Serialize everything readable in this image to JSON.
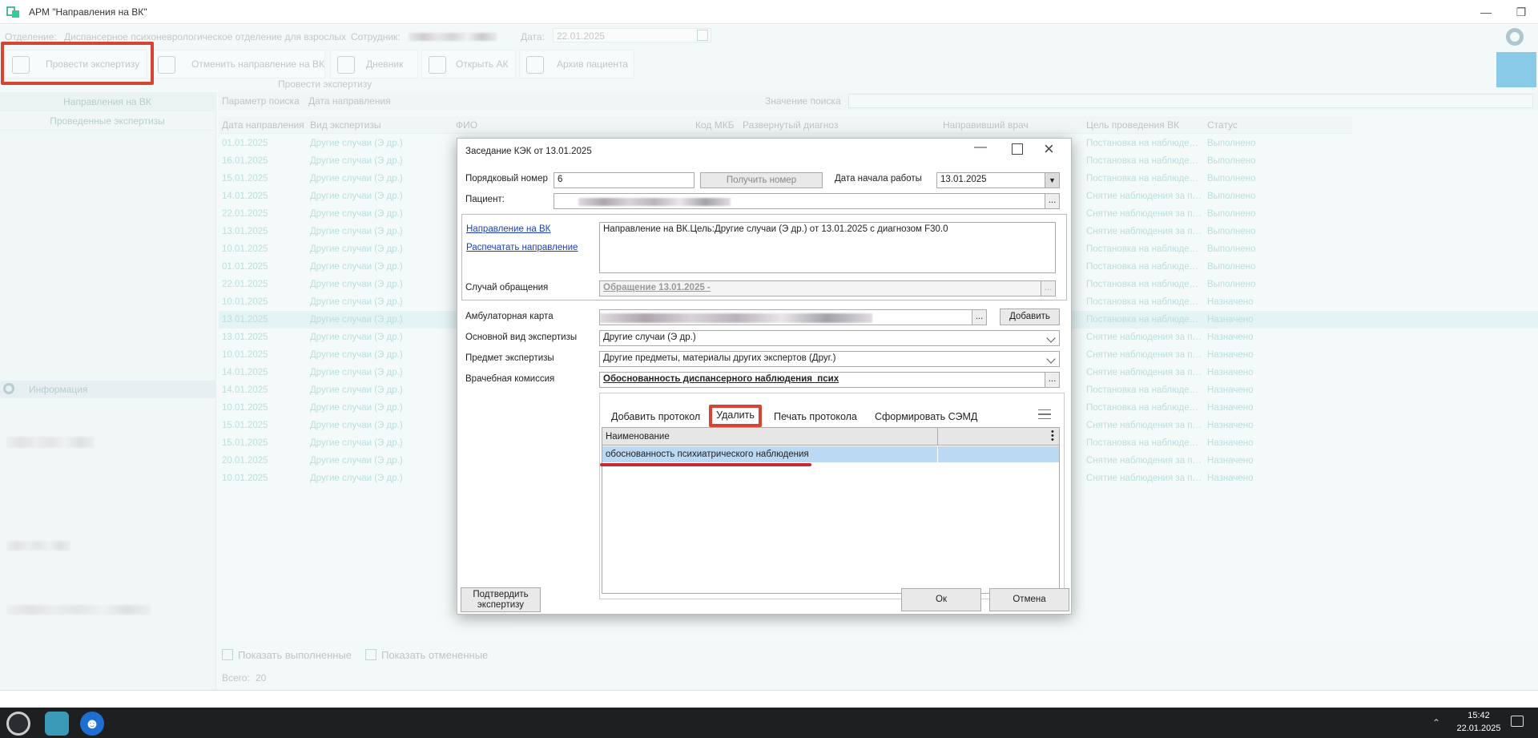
{
  "window": {
    "title": "АРМ \"Направления на ВК\""
  },
  "header": {
    "department_label": "Отделение:",
    "department_value": "Диспансерное психоневрологическое отделение для взрослых",
    "employee_label": "Сотрудник:",
    "date_label": "Дата:",
    "date_value": "22.01.2025"
  },
  "toolbar": {
    "items": [
      {
        "label": "Провести экспертизу",
        "icon": "experts-search-icon"
      },
      {
        "label": "Отменить направление на ВК",
        "icon": "experts-cancel-icon"
      },
      {
        "label": "Дневник",
        "icon": "book-icon"
      },
      {
        "label": "Открыть АК",
        "icon": "archive-box-icon"
      },
      {
        "label": "Архив пациента",
        "icon": "patient-archive-icon"
      }
    ],
    "group_caption": "Провести экспертизу",
    "accent_highlight": "#d64534"
  },
  "left_panel": {
    "items": [
      "Направления на ВК",
      "Проведенные экспертизы"
    ],
    "info_label": "Информация"
  },
  "search": {
    "param_label": "Параметр поиска",
    "param_value": "Дата направления",
    "value_label": "Значение поиска"
  },
  "grid": {
    "columns": [
      "Дата направления",
      "Вид экспертизы",
      "ФИО",
      "Код МКБ",
      "Развернутый диагноз",
      "Направивший врач",
      "Цель проведения ВК",
      "Статус"
    ],
    "rows": [
      {
        "date": "01.01.2025",
        "type": "Другие случаи (Э др.)",
        "goal": "Постановка на наблюдени...",
        "status": "Выполнено"
      },
      {
        "date": "16.01.2025",
        "type": "Другие случаи (Э др.)",
        "goal": "Постановка на наблюдени...",
        "status": "Выполнено"
      },
      {
        "date": "15.01.2025",
        "type": "Другие случаи (Э др.)",
        "goal": "Постановка на наблюдени...",
        "status": "Выполнено"
      },
      {
        "date": "14.01.2025",
        "type": "Другие случаи (Э др.)",
        "goal": "Снятие наблюдения за пац...",
        "status": "Выполнено"
      },
      {
        "date": "22.01.2025",
        "type": "Другие случаи (Э др.)",
        "goal": "Снятие наблюдения за пац...",
        "status": "Выполнено"
      },
      {
        "date": "13.01.2025",
        "type": "Другие случаи (Э др.)",
        "goal": "Снятие наблюдения за пац...",
        "status": "Выполнено"
      },
      {
        "date": "10.01.2025",
        "type": "Другие случаи (Э др.)",
        "goal": "Постановка на наблюдени...",
        "status": "Выполнено"
      },
      {
        "date": "01.01.2025",
        "type": "Другие случаи (Э др.)",
        "goal": "Постановка на наблюдени...",
        "status": "Выполнено"
      },
      {
        "date": "22.01.2025",
        "type": "Другие случаи (Э др.)",
        "goal": "Постановка на наблюдени...",
        "status": "Выполнено"
      },
      {
        "date": "10.01.2025",
        "type": "Другие случаи (Э др.)",
        "goal": "Постановка на наблюдени...",
        "status": "Назначено"
      },
      {
        "date": "13.01.2025",
        "type": "Другие случаи (Э др.)",
        "goal": "Постановка на наблюдени...",
        "status": "Назначено"
      },
      {
        "date": "13.01.2025",
        "type": "Другие случаи (Э др.)",
        "goal": "Снятие наблюдения за пац...",
        "status": "Назначено"
      },
      {
        "date": "10.01.2025",
        "type": "Другие случаи (Э др.)",
        "goal": "Снятие наблюдения за пац...",
        "status": "Назначено"
      },
      {
        "date": "14.01.2025",
        "type": "Другие случаи (Э др.)",
        "goal": "Снятие наблюдения за пац...",
        "status": "Назначено"
      },
      {
        "date": "14.01.2025",
        "type": "Другие случаи (Э др.)",
        "goal": "Постановка на наблюдени...",
        "status": "Назначено"
      },
      {
        "date": "10.01.2025",
        "type": "Другие случаи (Э др.)",
        "goal": "Постановка на наблюдени...",
        "status": "Назначено"
      },
      {
        "date": "15.01.2025",
        "type": "Другие случаи (Э др.)",
        "goal": "Снятие наблюдения за пац...",
        "status": "Назначено"
      },
      {
        "date": "15.01.2025",
        "type": "Другие случаи (Э др.)",
        "goal": "Постановка на наблюдени...",
        "status": "Назначено"
      },
      {
        "date": "20.01.2025",
        "type": "Другие случаи (Э др.)",
        "goal": "Снятие наблюдения за пац...",
        "status": "Назначено"
      },
      {
        "date": "10.01.2025",
        "type": "Другие случаи (Э др.)",
        "goal": "Снятие наблюдения за пац...",
        "status": "Назначено"
      }
    ],
    "show_done_label": "Показать выполненные",
    "show_cancelled_label": "Показать отмененные",
    "total_label": "Всего:",
    "total_value": "20"
  },
  "dialog": {
    "title": "Заседание КЭК от 13.01.2025",
    "seq_label": "Порядковый номер",
    "seq_value": "6",
    "get_number_button": "Получить номер",
    "start_date_label": "Дата начала работы",
    "start_date_value": "13.01.2025",
    "patient_label": "Пациент:",
    "referral_link": "Направление на ВК",
    "print_link": "Распечатать направление",
    "referral_text": "Направление на ВК.Цель:Другие случаи (Э др.) от 13.01.2025 с диагнозом F30.0",
    "case_label": "Случай обращения",
    "case_value": "Обращение 13.01.2025 -",
    "card_label": "Амбулаторная карта",
    "add_button": "Добавить",
    "main_type_label": "Основной вид экспертизы",
    "main_type_value": "Другие случаи (Э др.)",
    "subject_label": "Предмет экспертизы",
    "subject_value": "Другие предметы, материалы других экспертов (Друг.)",
    "commission_label": "Врачебная комиссия",
    "commission_value": "Обоснованность диспансерного наблюдения_псих",
    "protocol_tabs": [
      "Добавить протокол",
      "Удалить",
      "Печать протокола",
      "Сформировать СЭМД"
    ],
    "protocol_column": "Наименование",
    "protocol_rows": [
      "обоснованность психиатрического наблюдения"
    ],
    "confirm_button": "Подтвердить экспертизу",
    "ok_button": "Ок",
    "cancel_button": "Отмена"
  },
  "taskbar": {
    "time": "15:42",
    "date": "22.01.2025"
  }
}
